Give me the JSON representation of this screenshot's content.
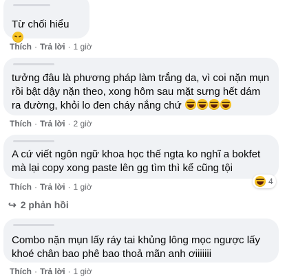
{
  "comments": [
    {
      "text": "Từ chối hiểu",
      "emojis": [
        "tired"
      ],
      "like_label": "Thích",
      "reply_label": "Trả lời",
      "time": "1 giờ"
    },
    {
      "text_lines": [
        "tưởng đâu là phương pháp làm trắng da, vì coi nặn mụn",
        "rồi bật dậy nặn theo, xong hôm sau mặt sưng hết dám",
        "ra đường, khỏi lo đen cháy nắng chứ"
      ],
      "emojis": [
        "laugh",
        "laugh",
        "laugh",
        "laugh"
      ],
      "like_label": "Thích",
      "reply_label": "Trả lời",
      "time": "2 giờ"
    },
    {
      "text_lines": [
        "A cứ viết ngôn ngữ khoa học thế ngta ko nghĩ a bokfet",
        "mà lại copy xong paste lên gg tìm thì kể cũng tội"
      ],
      "reaction_count": "4",
      "reaction_icon": "laugh",
      "like_label": "Thích",
      "reply_label": "Trả lời",
      "time": "1 giờ",
      "replies_label": "2 phản hồi"
    },
    {
      "text_lines": [
        "Combo nặn mụn lấy ráy tai khủng lông mọc ngược lấy",
        "khoé chân bao phê bao thoả mãn anh ơiiiiiii"
      ],
      "like_label": "Thích",
      "reply_label": "Trả lời",
      "time": "1 giờ"
    }
  ],
  "separator": "·",
  "colors": {
    "bubble": "#f0f2f5",
    "meta": "#65676b",
    "text": "#050505"
  }
}
